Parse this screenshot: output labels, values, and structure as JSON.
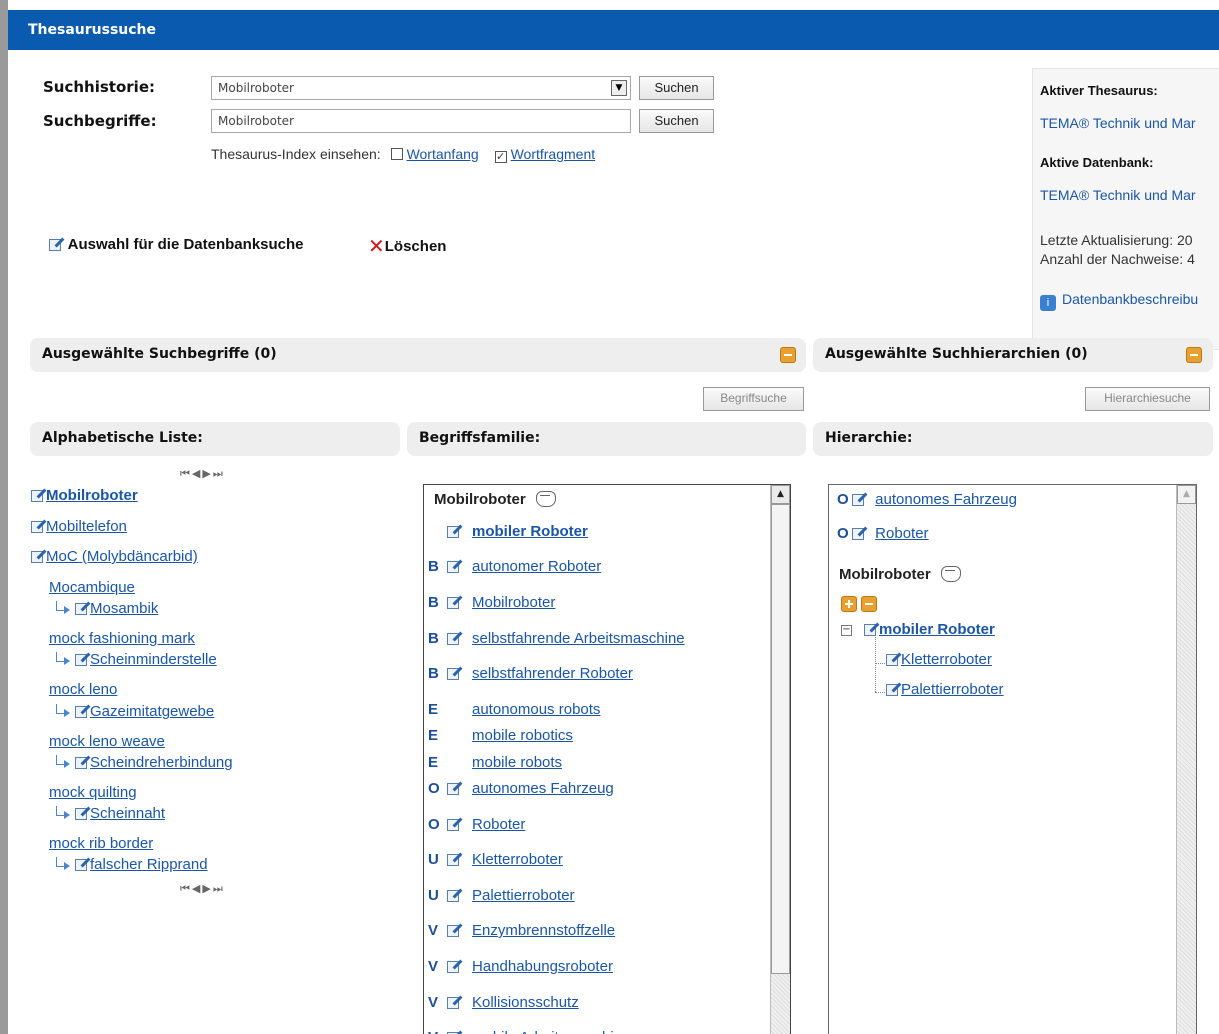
{
  "title": "Thesaurussuche",
  "search": {
    "history_label": "Suchhistorie:",
    "history_value": "Mobilroboter",
    "history_button": "Suchen",
    "terms_label": "Suchbegriffe:",
    "terms_value": "Mobilroboter",
    "terms_button": "Suchen",
    "index_label": "Thesaurus-Index einsehen:",
    "wortanfang": "Wortanfang",
    "wortanfang_checked": false,
    "wortfragment": "Wortfragment",
    "wortfragment_checked": true
  },
  "actions": {
    "select_db": "Auswahl für die Datenbanksuche",
    "delete": "Löschen"
  },
  "sidebar": {
    "active_thesaurus_label": "Aktiver Thesaurus:",
    "active_thesaurus_value": "TEMA® Technik und Mar",
    "active_db_label": "Aktive Datenbank:",
    "active_db_value": "TEMA® Technik und Mar",
    "last_update": "Letzte Aktualisierung: 20",
    "record_count": "Anzahl der Nachweise: 4",
    "db_description": "Datenbankbeschreibu"
  },
  "panels": {
    "selected_terms": "Ausgewählte Suchbegriffe (0)",
    "selected_hierarchies": "Ausgewählte Suchhierarchien (0)",
    "term_search_button": "Begriffsuche",
    "hierarchy_search_button": "Hierarchiesuche",
    "alpha_list": "Alphabetische Liste:",
    "term_family": "Begriffsfamilie:",
    "hierarchy": "Hierarchie:"
  },
  "alpha_list": {
    "items": [
      {
        "label": "Mobilroboter",
        "bold": true,
        "type": "pen"
      },
      {
        "label": "Mobiltelefon",
        "type": "pen"
      },
      {
        "label": "MoC (Molybdäncarbid)",
        "type": "pen"
      },
      {
        "label": "Mocambique",
        "type": "term"
      },
      {
        "label": "Mosambik",
        "type": "sub"
      },
      {
        "label": "mock fashioning mark",
        "type": "term"
      },
      {
        "label": "Scheinminderstelle",
        "type": "sub"
      },
      {
        "label": "mock leno",
        "type": "term"
      },
      {
        "label": "Gazeimitatgewebe",
        "type": "sub"
      },
      {
        "label": "mock leno weave",
        "type": "term"
      },
      {
        "label": "Scheindreherbindung",
        "type": "sub"
      },
      {
        "label": "mock quilting",
        "type": "term"
      },
      {
        "label": "Scheinnaht",
        "type": "sub"
      },
      {
        "label": "mock rib border",
        "type": "term"
      },
      {
        "label": "falscher Ripprand",
        "type": "sub"
      }
    ]
  },
  "family": {
    "head": "Mobilroboter",
    "rows": [
      {
        "code": "",
        "label": "mobiler Roboter",
        "bold": true,
        "pen": true
      },
      {
        "code": "B",
        "label": "autonomer Roboter",
        "pen": true
      },
      {
        "code": "B",
        "label": "Mobilroboter",
        "pen": true
      },
      {
        "code": "B",
        "label": "selbstfahrende Arbeitsmaschine",
        "pen": true
      },
      {
        "code": "B",
        "label": "selbstfahrender Roboter",
        "pen": true
      },
      {
        "code": "E",
        "label": "autonomous robots",
        "pen": false
      },
      {
        "code": "E",
        "label": "mobile robotics",
        "pen": false
      },
      {
        "code": "E",
        "label": "mobile robots",
        "pen": false
      },
      {
        "code": "O",
        "label": "autonomes Fahrzeug",
        "pen": true
      },
      {
        "code": "O",
        "label": "Roboter",
        "pen": true
      },
      {
        "code": "U",
        "label": "Kletterroboter",
        "pen": true
      },
      {
        "code": "U",
        "label": "Palettierroboter",
        "pen": true
      },
      {
        "code": "V",
        "label": "Enzymbrennstoffzelle",
        "pen": true
      },
      {
        "code": "V",
        "label": "Handhabungsroboter",
        "pen": true
      },
      {
        "code": "V",
        "label": "Kollisionsschutz",
        "pen": true
      },
      {
        "code": "V",
        "label": "mobile Arbeitsmaschine",
        "pen": true
      }
    ]
  },
  "hierarchy": {
    "o1_code": "O",
    "o1": "autonomes Fahrzeug",
    "o2_code": "O",
    "o2": "Roboter",
    "head": "Mobilroboter",
    "root": "mobiler Roboter",
    "children": [
      "Kletterroboter",
      "Palettierroboter"
    ]
  }
}
